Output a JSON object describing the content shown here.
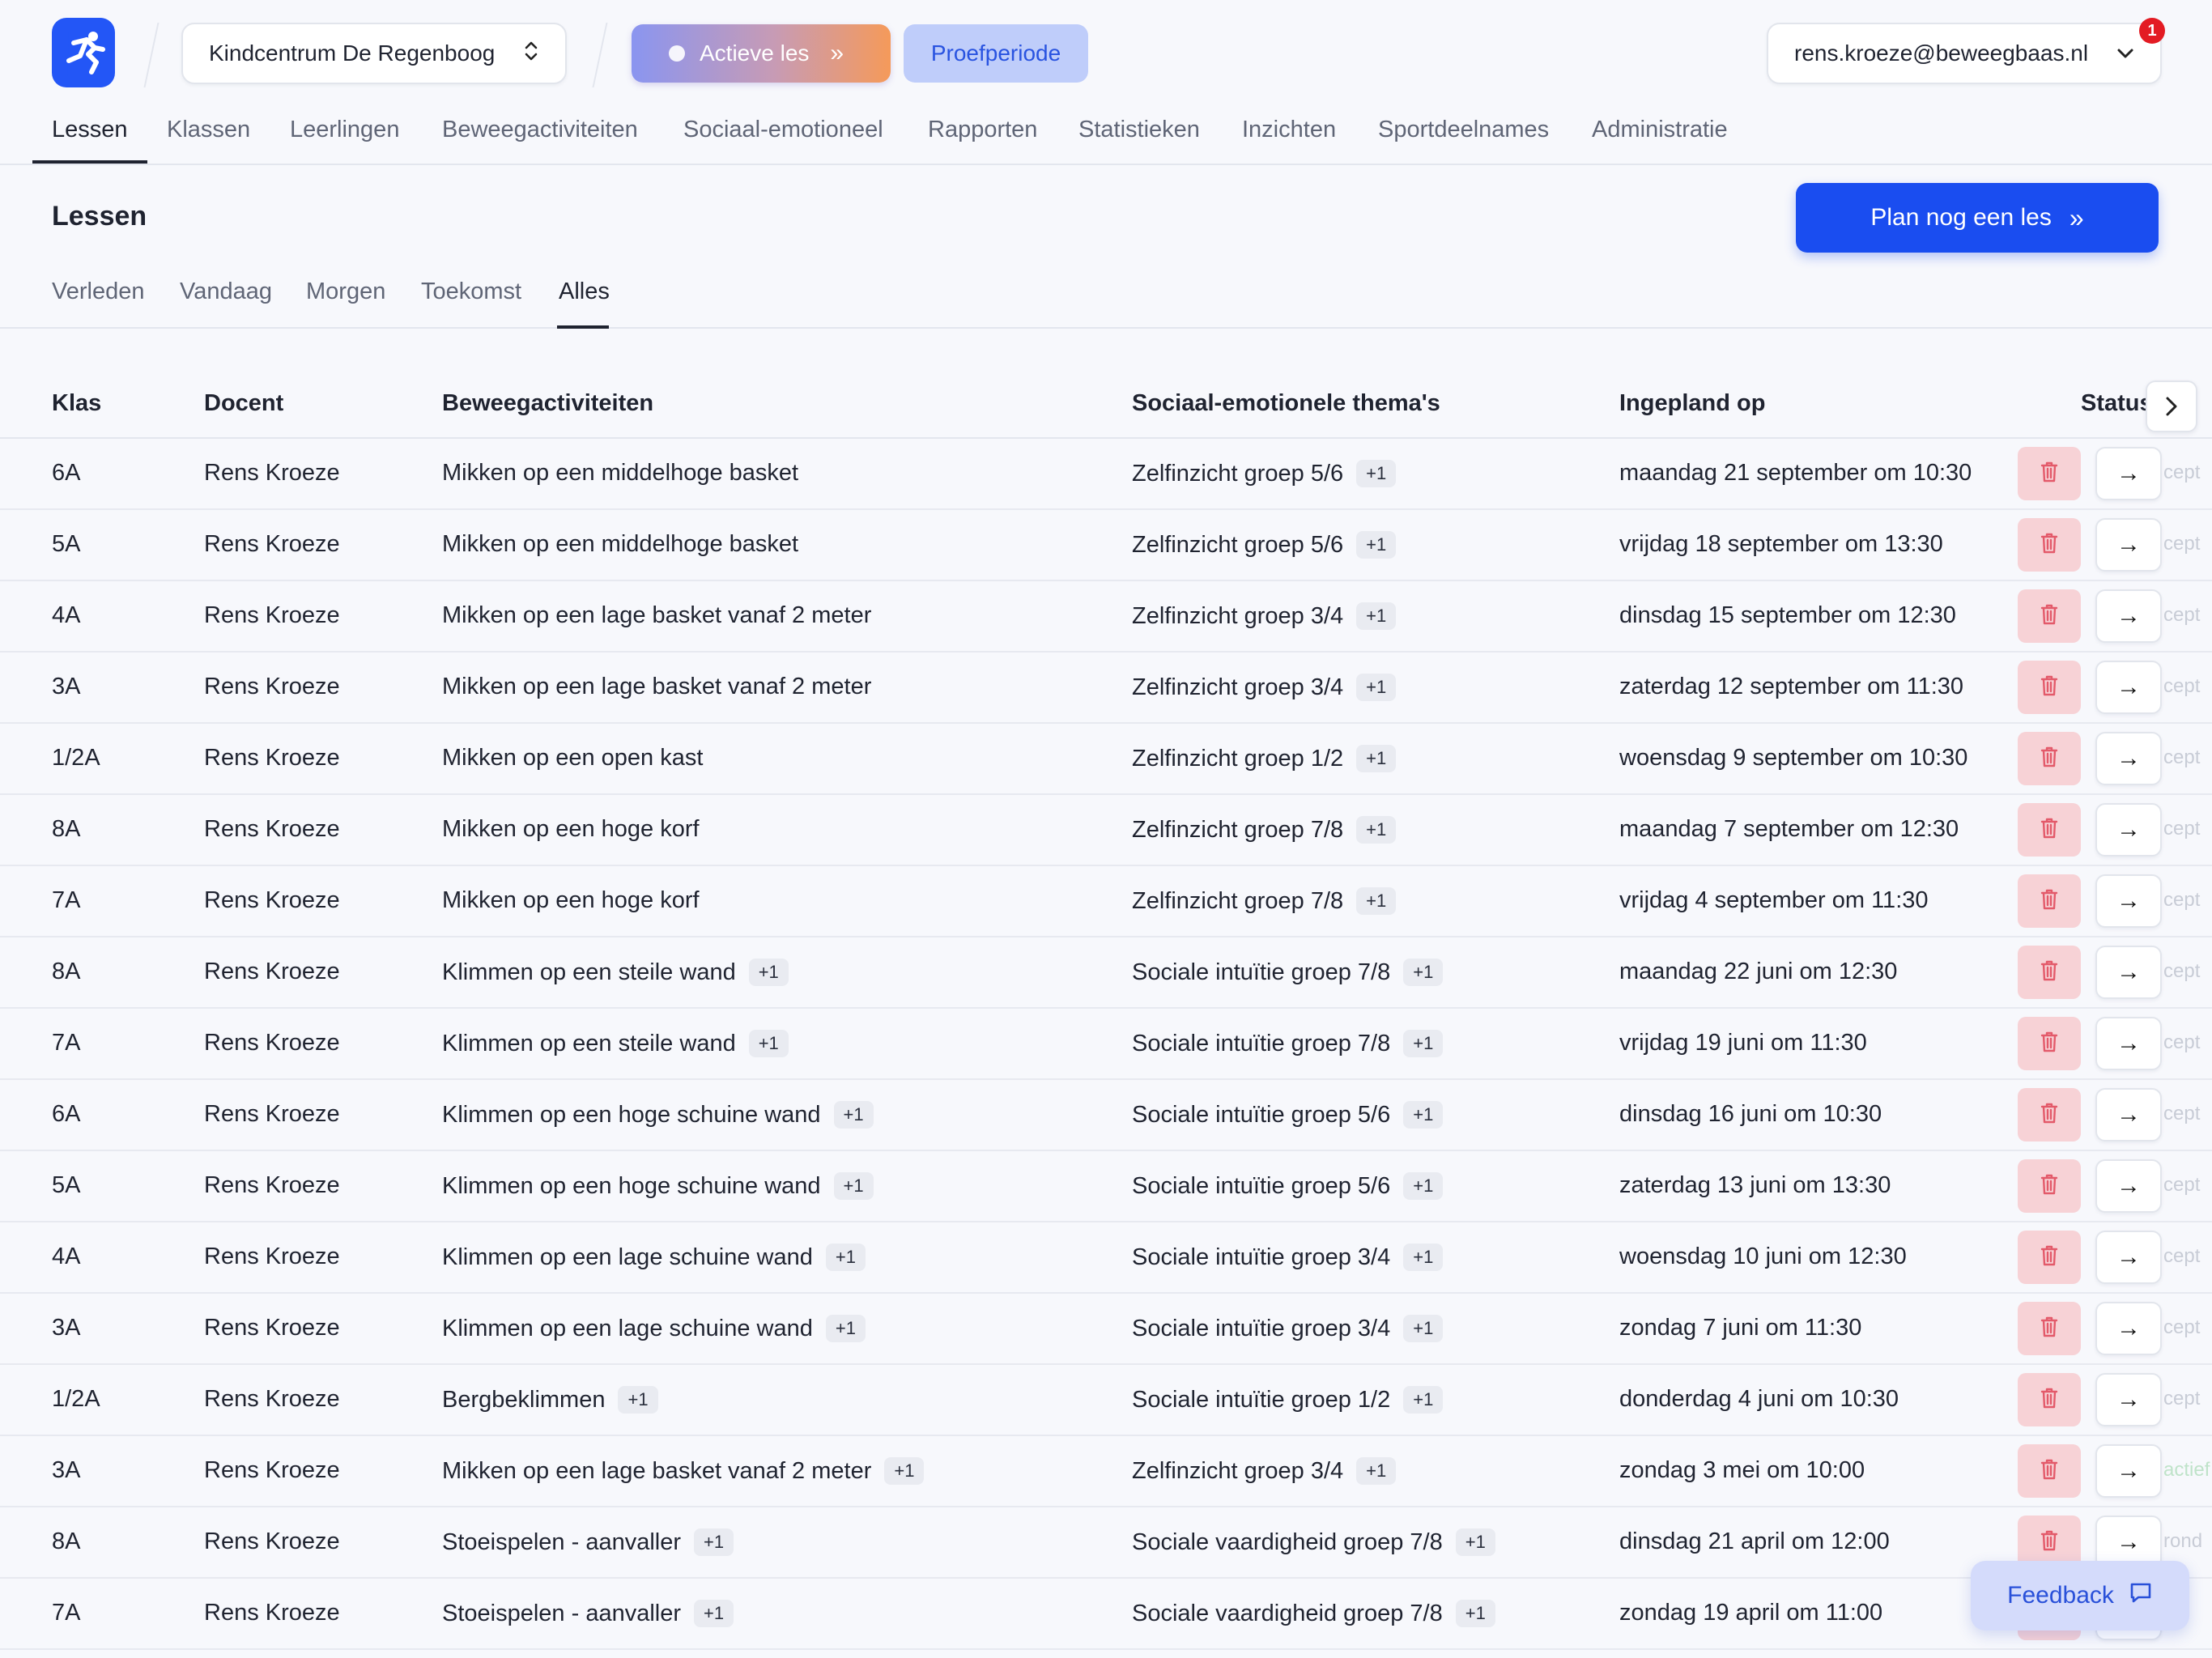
{
  "header": {
    "school": "Kindcentrum De Regenboog",
    "active_lesson_label": "Actieve les",
    "trial_label": "Proefperiode",
    "user_email": "rens.kroeze@beweegbaas.nl",
    "notification_count": "1"
  },
  "main_nav": [
    "Lessen",
    "Klassen",
    "Leerlingen",
    "Beweegactiviteiten",
    "Sociaal-emotioneel",
    "Rapporten",
    "Statistieken",
    "Inzichten",
    "Sportdeelnames",
    "Administratie"
  ],
  "page": {
    "title": "Lessen",
    "plan_button": "Plan nog een les"
  },
  "sub_nav": [
    "Verleden",
    "Vandaag",
    "Morgen",
    "Toekomst",
    "Alles"
  ],
  "table": {
    "headers": [
      "Klas",
      "Docent",
      "Beweegactiviteiten",
      "Sociaal-emotionele thema's",
      "Ingepland op",
      "Status"
    ],
    "rows": [
      {
        "klas": "6A",
        "docent": "Rens Kroeze",
        "activiteit": "Mikken op een middelhoge basket",
        "activiteit_extra": "",
        "thema": "Zelfinzicht groep 5/6",
        "thema_extra": "+1",
        "datum": "maandag 21 september om 10:30",
        "status": "cept"
      },
      {
        "klas": "5A",
        "docent": "Rens Kroeze",
        "activiteit": "Mikken op een middelhoge basket",
        "activiteit_extra": "",
        "thema": "Zelfinzicht groep 5/6",
        "thema_extra": "+1",
        "datum": "vrijdag 18 september om 13:30",
        "status": "cept"
      },
      {
        "klas": "4A",
        "docent": "Rens Kroeze",
        "activiteit": "Mikken op een lage basket vanaf 2 meter",
        "activiteit_extra": "",
        "thema": "Zelfinzicht groep 3/4",
        "thema_extra": "+1",
        "datum": "dinsdag 15 september om 12:30",
        "status": "cept"
      },
      {
        "klas": "3A",
        "docent": "Rens Kroeze",
        "activiteit": "Mikken op een lage basket vanaf 2 meter",
        "activiteit_extra": "",
        "thema": "Zelfinzicht groep 3/4",
        "thema_extra": "+1",
        "datum": "zaterdag 12 september om 11:30",
        "status": "cept"
      },
      {
        "klas": "1/2A",
        "docent": "Rens Kroeze",
        "activiteit": "Mikken op een open kast",
        "activiteit_extra": "",
        "thema": "Zelfinzicht groep 1/2",
        "thema_extra": "+1",
        "datum": "woensdag 9 september om 10:30",
        "status": "cept"
      },
      {
        "klas": "8A",
        "docent": "Rens Kroeze",
        "activiteit": "Mikken op een hoge korf",
        "activiteit_extra": "",
        "thema": "Zelfinzicht groep 7/8",
        "thema_extra": "+1",
        "datum": "maandag 7 september om 12:30",
        "status": "cept"
      },
      {
        "klas": "7A",
        "docent": "Rens Kroeze",
        "activiteit": "Mikken op een hoge korf",
        "activiteit_extra": "",
        "thema": "Zelfinzicht groep 7/8",
        "thema_extra": "+1",
        "datum": "vrijdag 4 september om 11:30",
        "status": "cept"
      },
      {
        "klas": "8A",
        "docent": "Rens Kroeze",
        "activiteit": "Klimmen op een steile wand",
        "activiteit_extra": "+1",
        "thema": "Sociale intuïtie groep 7/8",
        "thema_extra": "+1",
        "datum": "maandag 22 juni om 12:30",
        "status": "cept"
      },
      {
        "klas": "7A",
        "docent": "Rens Kroeze",
        "activiteit": "Klimmen op een steile wand",
        "activiteit_extra": "+1",
        "thema": "Sociale intuïtie groep 7/8",
        "thema_extra": "+1",
        "datum": "vrijdag 19 juni om 11:30",
        "status": "cept"
      },
      {
        "klas": "6A",
        "docent": "Rens Kroeze",
        "activiteit": "Klimmen op een hoge schuine wand",
        "activiteit_extra": "+1",
        "thema": "Sociale intuïtie groep 5/6",
        "thema_extra": "+1",
        "datum": "dinsdag 16 juni om 10:30",
        "status": "cept"
      },
      {
        "klas": "5A",
        "docent": "Rens Kroeze",
        "activiteit": "Klimmen op een hoge schuine wand",
        "activiteit_extra": "+1",
        "thema": "Sociale intuïtie groep 5/6",
        "thema_extra": "+1",
        "datum": "zaterdag 13 juni om 13:30",
        "status": "cept"
      },
      {
        "klas": "4A",
        "docent": "Rens Kroeze",
        "activiteit": "Klimmen op een lage schuine wand",
        "activiteit_extra": "+1",
        "thema": "Sociale intuïtie groep 3/4",
        "thema_extra": "+1",
        "datum": "woensdag 10 juni om 12:30",
        "status": "cept"
      },
      {
        "klas": "3A",
        "docent": "Rens Kroeze",
        "activiteit": "Klimmen op een lage schuine wand",
        "activiteit_extra": "+1",
        "thema": "Sociale intuïtie groep 3/4",
        "thema_extra": "+1",
        "datum": "zondag 7 juni om 11:30",
        "status": "cept"
      },
      {
        "klas": "1/2A",
        "docent": "Rens Kroeze",
        "activiteit": "Bergbeklimmen",
        "activiteit_extra": "+1",
        "thema": "Sociale intuïtie groep 1/2",
        "thema_extra": "+1",
        "datum": "donderdag 4 juni om 10:30",
        "status": "cept"
      },
      {
        "klas": "3A",
        "docent": "Rens Kroeze",
        "activiteit": "Mikken op een lage basket vanaf 2 meter",
        "activiteit_extra": "+1",
        "thema": "Zelfinzicht groep 3/4",
        "thema_extra": "+1",
        "datum": "zondag 3 mei om 10:00",
        "status": "actief"
      },
      {
        "klas": "8A",
        "docent": "Rens Kroeze",
        "activiteit": "Stoeispelen - aanvaller",
        "activiteit_extra": "+1",
        "thema": "Sociale vaardigheid groep 7/8",
        "thema_extra": "+1",
        "datum": "dinsdag 21 april om 12:00",
        "status": "rond"
      },
      {
        "klas": "7A",
        "docent": "Rens Kroeze",
        "activiteit": "Stoeispelen - aanvaller",
        "activiteit_extra": "+1",
        "thema": "Sociale vaardigheid groep 7/8",
        "thema_extra": "+1",
        "datum": "zondag 19 april om 11:00",
        "status": "nd"
      }
    ]
  },
  "feedback_label": "Feedback",
  "colors": {
    "primary": "#1a4df0",
    "delete_bg": "#f7d2d6",
    "delete_icon": "#e35a6a",
    "notification": "#e31b23"
  }
}
